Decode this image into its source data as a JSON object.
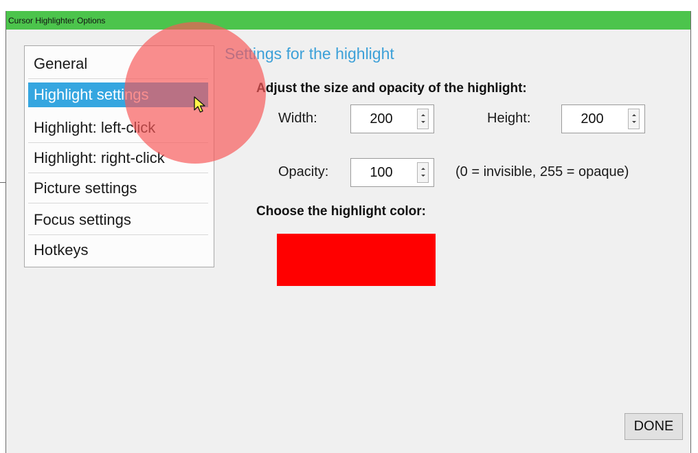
{
  "window": {
    "title": "Cursor Highlighter Options",
    "titlebar_color": "#4cc44c"
  },
  "sidebar": {
    "items": [
      {
        "label": "General"
      },
      {
        "label": "Highlight settings",
        "selected": true
      },
      {
        "label": "Highlight: left-click"
      },
      {
        "label": "Highlight: right-click"
      },
      {
        "label": "Picture settings"
      },
      {
        "label": "Focus settings"
      },
      {
        "label": "Hotkeys"
      }
    ],
    "selected_color": "#35a6e0"
  },
  "main": {
    "section_title": "Settings for the highlight",
    "size_heading": "Adjust the size and opacity of the highlight:",
    "width": {
      "label": "Width:",
      "value": "200"
    },
    "height": {
      "label": "Height:",
      "value": "200"
    },
    "opacity": {
      "label": "Opacity:",
      "value": "100",
      "hint": "(0 = invisible, 255 = opaque)"
    },
    "color_heading": "Choose the highlight color:",
    "highlight_color": "#ff0000"
  },
  "footer": {
    "done_label": "DONE"
  },
  "icons": {
    "cursor": "arrow-cursor-icon"
  }
}
